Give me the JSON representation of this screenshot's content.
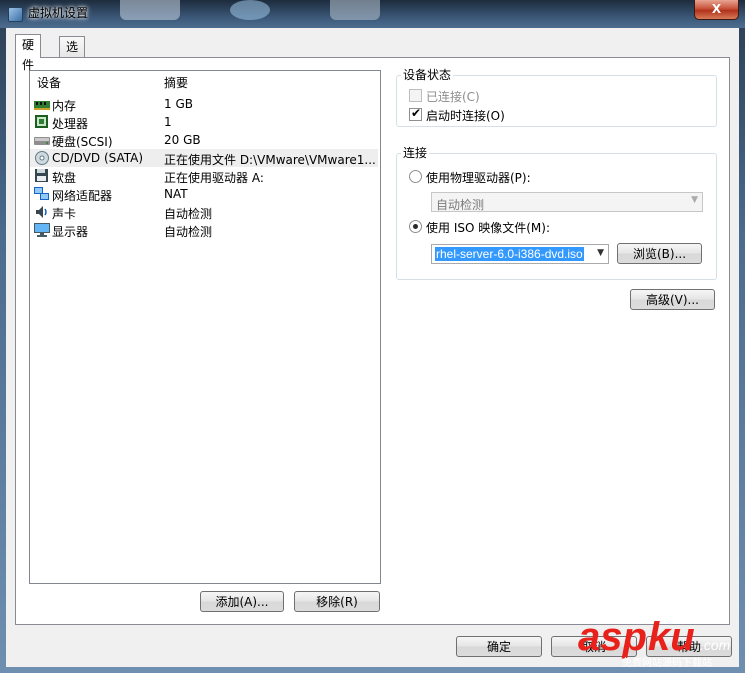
{
  "window": {
    "title": "虚拟机设置",
    "close_glyph": "X"
  },
  "tabs": [
    {
      "label": "硬件"
    },
    {
      "label": "选项"
    }
  ],
  "device_list": {
    "columns": {
      "device": "设备",
      "summary": "摘要"
    },
    "rows": [
      {
        "name": "内存",
        "summary": "1 GB",
        "icon": "memory-icon"
      },
      {
        "name": "处理器",
        "summary": "1",
        "icon": "cpu-icon"
      },
      {
        "name": "硬盘(SCSI)",
        "summary": "20 GB",
        "icon": "hard-disk-icon"
      },
      {
        "name": "CD/DVD (SATA)",
        "summary": "正在使用文件 D:\\VMware\\VMware1...",
        "icon": "cd-dvd-icon",
        "selected": true
      },
      {
        "name": "软盘",
        "summary": "正在使用驱动器 A:",
        "icon": "floppy-icon"
      },
      {
        "name": "网络适配器",
        "summary": "NAT",
        "icon": "network-adapter-icon"
      },
      {
        "name": "声卡",
        "summary": "自动检测",
        "icon": "sound-card-icon"
      },
      {
        "name": "显示器",
        "summary": "自动检测",
        "icon": "monitor-icon"
      }
    ]
  },
  "buttons": {
    "add": "添加(A)...",
    "remove": "移除(R)",
    "browse": "浏览(B)...",
    "advanced": "高级(V)...",
    "ok": "确定",
    "cancel": "取消",
    "help": "帮助"
  },
  "device_status": {
    "title": "设备状态",
    "connected": {
      "label": "已连接(C)",
      "checked": false,
      "disabled": true
    },
    "connect_at_power_on": {
      "label": "启动时连接(O)",
      "checked": true
    }
  },
  "connection": {
    "title": "连接",
    "physical": {
      "label": "使用物理驱动器(P):",
      "selected": false
    },
    "physical_value": "自动检测",
    "iso": {
      "label": "使用 ISO 映像文件(M):",
      "selected": true
    },
    "iso_value": "rhel-server-6.0-i386-dvd.iso"
  },
  "watermark": {
    "brand": "aspku",
    "sub": "免费网站源码下载站",
    "suffix": ".com"
  },
  "colors": {
    "selection": "#3399ff",
    "watermark_red": "#e8221b"
  }
}
